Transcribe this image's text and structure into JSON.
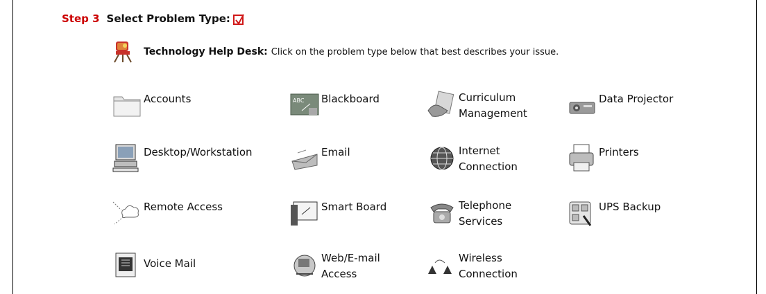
{
  "step": {
    "label": "Step 3",
    "title": "Select Problem Type:",
    "check_icon": "red-checkbox-icon"
  },
  "helpdesk": {
    "icon": "helpdesk-chair-icon",
    "title": "Technology Help Desk:",
    "description": "Click on the problem type below that best describes your issue."
  },
  "colors": {
    "step_label": "#cc0000",
    "checkbox": "#d01818"
  },
  "problem_types": [
    {
      "label": "Accounts",
      "icon": "folder-icon"
    },
    {
      "label": "Blackboard",
      "icon": "chalkboard-icon"
    },
    {
      "label": "Curriculum\nManagement",
      "icon": "hand-document-icon"
    },
    {
      "label": "Data Projector",
      "icon": "projector-icon"
    },
    {
      "label": "Desktop/Workstation",
      "icon": "desktop-computer-icon"
    },
    {
      "label": "Email",
      "icon": "envelope-icon"
    },
    {
      "label": "Internet\nConnection",
      "icon": "globe-icon"
    },
    {
      "label": "Printers",
      "icon": "printer-icon"
    },
    {
      "label": "Remote Access",
      "icon": "cloud-network-icon"
    },
    {
      "label": "Smart Board",
      "icon": "smart-board-icon"
    },
    {
      "label": "Telephone\nServices",
      "icon": "telephone-icon"
    },
    {
      "label": "UPS Backup",
      "icon": "power-outlet-icon"
    },
    {
      "label": "Voice Mail",
      "icon": "voicemail-phone-icon"
    },
    {
      "label": "Web/E-mail\nAccess",
      "icon": "web-email-icon"
    },
    {
      "label": "Wireless\nConnection",
      "icon": "wireless-icon"
    }
  ]
}
